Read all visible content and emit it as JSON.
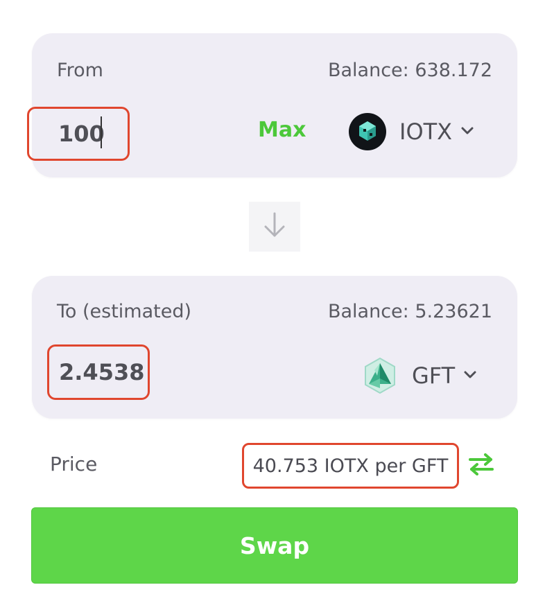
{
  "from": {
    "label": "From",
    "balance": "Balance: 638.172",
    "amount": "100",
    "max_label": "Max",
    "token": {
      "symbol": "IOTX",
      "icon": "iotx-token-icon"
    }
  },
  "to": {
    "label": "To (estimated)",
    "balance": "Balance: 5.23621",
    "amount": "2.4538",
    "token": {
      "symbol": "GFT",
      "icon": "gft-token-icon"
    }
  },
  "price": {
    "label": "Price",
    "value": "40.753 IOTX per GFT",
    "switch_icon": "swap-arrows-icon"
  },
  "swap_button": {
    "label": "Swap"
  },
  "colors": {
    "accent_green": "#5ed649",
    "max_green": "#4cc83a",
    "highlight_red": "#e0462e",
    "card_bg": "#efedf5"
  }
}
